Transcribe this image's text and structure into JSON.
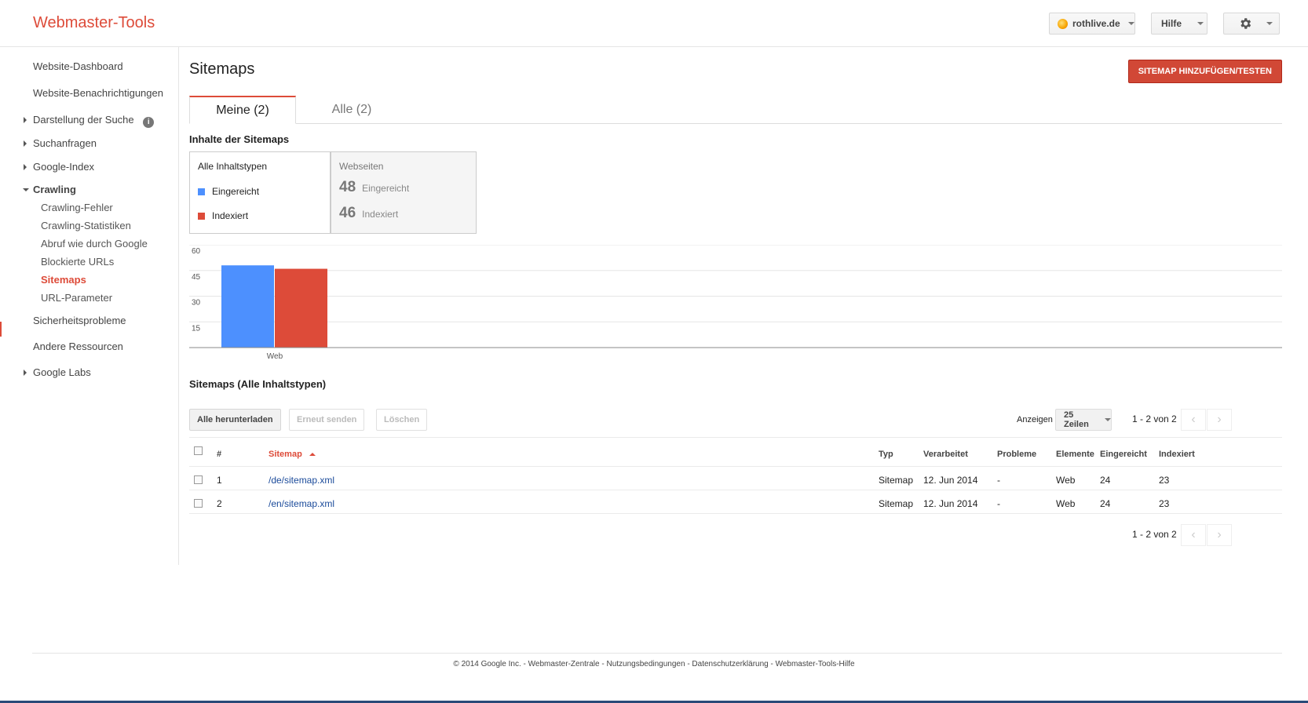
{
  "header": {
    "logo": "Webmaster-Tools",
    "site_selector": "rothlive.de",
    "help_label": "Hilfe"
  },
  "sidebar": {
    "items": [
      {
        "label": "Website-Dashboard"
      },
      {
        "label": "Website-Benachrichtigungen"
      },
      {
        "label": "Darstellung der Suche"
      },
      {
        "label": "Suchanfragen"
      },
      {
        "label": "Google-Index"
      },
      {
        "label": "Crawling"
      },
      {
        "label": "Crawling-Fehler"
      },
      {
        "label": "Crawling-Statistiken"
      },
      {
        "label": "Abruf wie durch Google"
      },
      {
        "label": "Blockierte URLs"
      },
      {
        "label": "Sitemaps"
      },
      {
        "label": "URL-Parameter"
      },
      {
        "label": "Sicherheitsprobleme"
      },
      {
        "label": "Andere Ressourcen"
      },
      {
        "label": "Google Labs"
      }
    ],
    "info_glyph": "i"
  },
  "main": {
    "title": "Sitemaps",
    "add_button": "SITEMAP HINZUFÜGEN/TESTEN",
    "tabs": [
      {
        "label": "Meine (2)"
      },
      {
        "label": "Alle (2)"
      }
    ],
    "content_title": "Inhalte der Sitemaps",
    "legend": {
      "title": "Alle Inhaltstypen",
      "submitted": "Eingereicht",
      "indexed": "Indexiert"
    },
    "stats": {
      "label": "Webseiten",
      "submitted_value": "48",
      "submitted_label": "Eingereicht",
      "indexed_value": "46",
      "indexed_label": "Indexiert"
    },
    "list_title": "Sitemaps (Alle Inhaltstypen)",
    "toolbar": {
      "download": "Alle herunterladen",
      "resend": "Erneut senden",
      "delete": "Löschen",
      "show_label": "Anzeigen",
      "rows_select": "25 Zeilen",
      "pager": "1 - 2 von 2"
    },
    "table": {
      "headers": {
        "num": "#",
        "sitemap": "Sitemap",
        "type": "Typ",
        "processed": "Verarbeitet",
        "problems": "Probleme",
        "elements": "Elemente",
        "submitted": "Eingereicht",
        "indexed": "Indexiert"
      },
      "rows": [
        {
          "num": "1",
          "sitemap": "/de/sitemap.xml",
          "type": "Sitemap",
          "processed": "12. Jun 2014",
          "problems": "-",
          "elements": "Web",
          "submitted": "24",
          "indexed": "23"
        },
        {
          "num": "2",
          "sitemap": "/en/sitemap.xml",
          "type": "Sitemap",
          "processed": "12. Jun 2014",
          "problems": "-",
          "elements": "Web",
          "submitted": "24",
          "indexed": "23"
        }
      ]
    },
    "pager_bottom": "1 - 2 von 2",
    "prev_glyph": "‹",
    "next_glyph": "›"
  },
  "chart_data": {
    "type": "bar",
    "categories": [
      "Web"
    ],
    "series": [
      {
        "name": "Eingereicht",
        "values": [
          48
        ],
        "color": "#4d90fe"
      },
      {
        "name": "Indexiert",
        "values": [
          46
        ],
        "color": "#dd4b39"
      }
    ],
    "yticks": [
      15,
      30,
      45,
      60
    ],
    "ylim": [
      0,
      60
    ],
    "grid": true
  },
  "colors": {
    "accent": "#dd4b39",
    "submitted": "#4d90fe",
    "indexed": "#dd4b39",
    "link": "#1a4a9a"
  },
  "footer": {
    "text": "© 2014 Google Inc. - Webmaster-Zentrale - Nutzungsbedingungen - Datenschutzerklärung - Webmaster-Tools-Hilfe"
  }
}
